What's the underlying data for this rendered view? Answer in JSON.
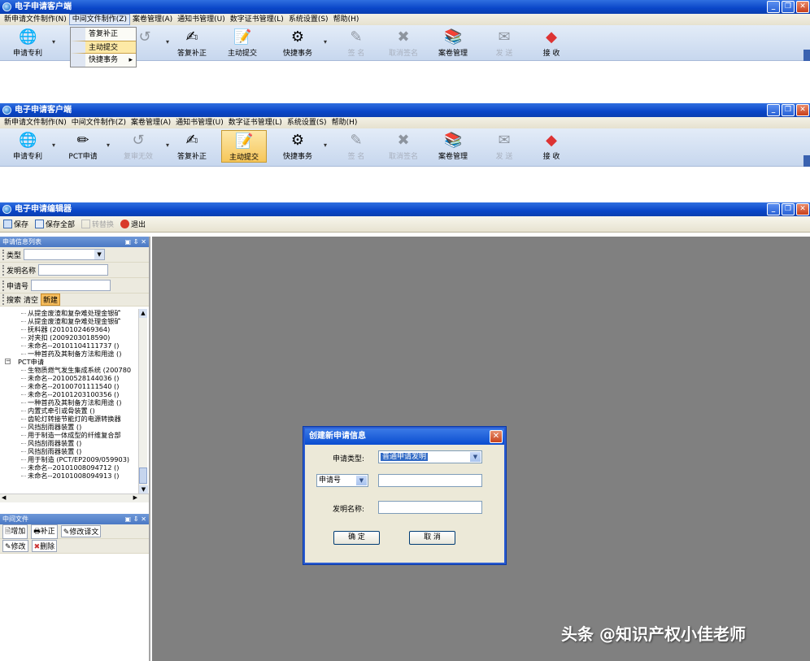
{
  "top_window": {
    "title": "电子申请客户端",
    "menu": [
      "新申请文件制作(N)",
      "中间文件制作(Z)",
      "案卷管理(A)",
      "通知书管理(U)",
      "数字证书管理(L)",
      "系统设置(S)",
      "帮助(H)"
    ],
    "toolbar": [
      {
        "label": "申请专利",
        "icon": "globe-icon"
      },
      {
        "label": "答复补正",
        "icon": "pen-icon"
      },
      {
        "label": "主动提交",
        "icon": "submit-icon"
      },
      {
        "label": "快捷事务",
        "icon": "tasks-icon"
      },
      {
        "label": "签 名",
        "icon": "sign-icon"
      },
      {
        "label": "取消签名",
        "icon": "unsign-icon"
      },
      {
        "label": "案卷管理",
        "icon": "books-icon"
      },
      {
        "label": "发 送",
        "icon": "send-icon"
      },
      {
        "label": "接 收",
        "icon": "receive-icon"
      }
    ],
    "dropdown": [
      "答复补正",
      "主动提交",
      "快捷事务"
    ]
  },
  "second_window": {
    "title": "电子申请客户端",
    "menu": [
      "新申请文件制作(N)",
      "中间文件制作(Z)",
      "案卷管理(A)",
      "通知书管理(U)",
      "数字证书管理(L)",
      "系统设置(S)",
      "帮助(H)"
    ],
    "toolbar": [
      {
        "label": "申请专利",
        "icon": "globe-icon"
      },
      {
        "label": "PCT申请",
        "icon": "pct-icon"
      },
      {
        "label": "复审无效",
        "icon": "review-icon"
      },
      {
        "label": "答复补正",
        "icon": "pen-icon"
      },
      {
        "label": "主动提交",
        "icon": "submit-icon"
      },
      {
        "label": "快捷事务",
        "icon": "tasks-icon"
      },
      {
        "label": "签 名",
        "icon": "sign-icon"
      },
      {
        "label": "取消签名",
        "icon": "unsign-icon"
      },
      {
        "label": "案卷管理",
        "icon": "books-icon"
      },
      {
        "label": "发 送",
        "icon": "send-icon"
      },
      {
        "label": "接 收",
        "icon": "receive-icon"
      }
    ]
  },
  "editor": {
    "title": "电子申请编辑器",
    "toolbar": {
      "save": "保存",
      "save_all": "保存全部",
      "convert": "转替换",
      "exit": "退出"
    },
    "list_panel": {
      "title": "申请信息列表",
      "ctrls": "▣ ⇩ ✕",
      "type_label": "类型",
      "name_label": "发明名称",
      "number_label": "申请号",
      "search": "搜索",
      "clear": "清空",
      "new": "新建"
    },
    "tree": {
      "group_a_items": [
        "从提金废渣和复杂难处理金银矿",
        "从提金废渣和复杂难处理金银矿",
        "抚料器 (2010102469364)",
        "对夹扣 (2009203018590)",
        "未命名--20101104111737 ()",
        "一种首药及其制备方法和用途 ()"
      ],
      "group_b_label": "PCT申请",
      "group_b_items": [
        "生物质燃气发生集成系统 (200780",
        "未命名--20100528144036 ()",
        "未命名--20100701111540 ()",
        "未命名--20101203100356 ()",
        "一种首药及其制备方法和用途 ()",
        "内置式牵引或骨装置 ()",
        "齿轮灯转接节能灯的电源转换器",
        "风挡刮雨器装置 ()",
        "用于制造一体成型的纤维复合部",
        "风挡刮雨器装置 ()",
        "风挡刮雨器装置 ()",
        "用于制造 (PCT/EP2009/059903)",
        "未命名--20101008094712 ()",
        "未命名--20101008094913 ()"
      ]
    },
    "mid_panel": {
      "title": "中间文件",
      "ctrls": "▣ ⇩ ✕",
      "add": "增加",
      "supplement": "补正",
      "edit_translation": "修改译文",
      "modify": "修改",
      "delete": "删除"
    }
  },
  "dialog": {
    "title": "创建新申请信息",
    "type_label": "申请类型:",
    "type_value": "普通申请发明",
    "number_select": "申请号",
    "name_label": "发明名称:",
    "ok": "确 定",
    "cancel": "取 消"
  },
  "watermark": "头条 @知识产权小佳老师"
}
